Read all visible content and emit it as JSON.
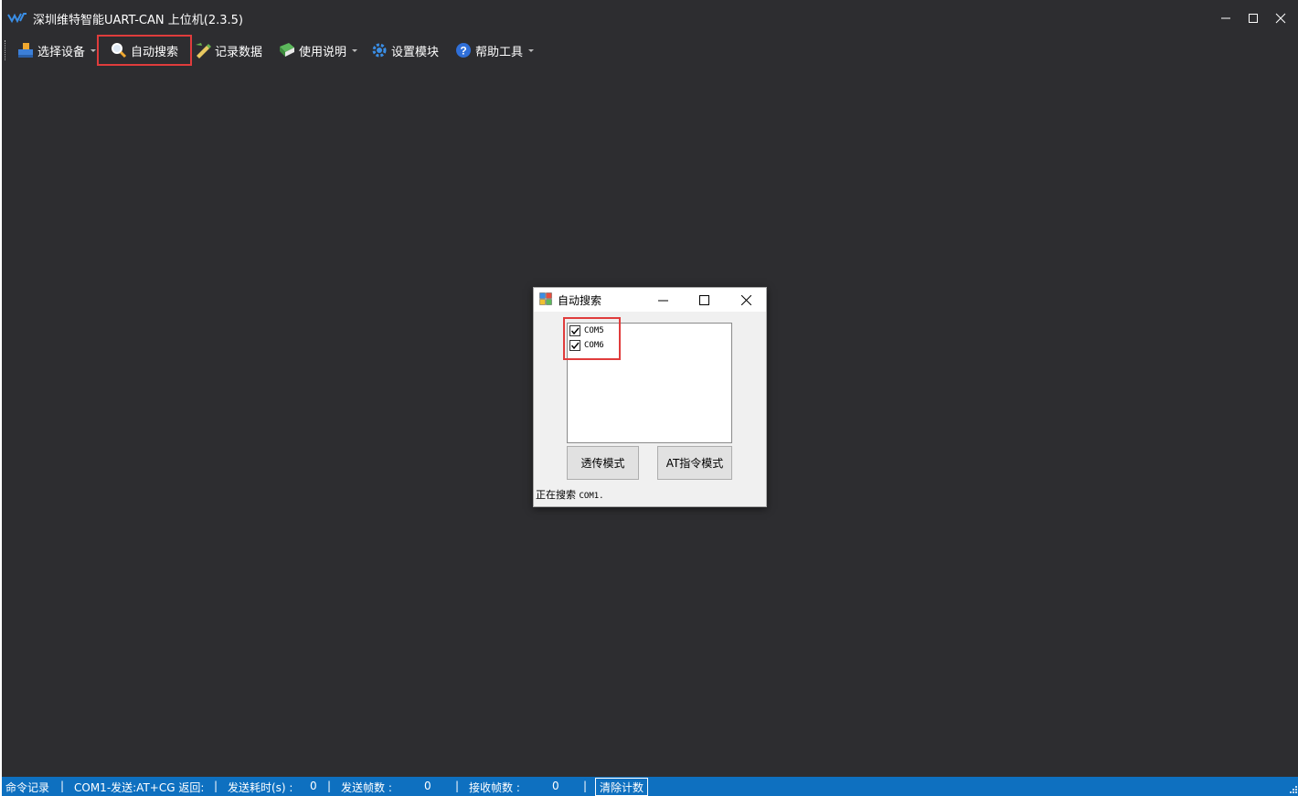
{
  "app": {
    "title": "深圳维特智能UART-CAN 上位机(2.3.5)"
  },
  "toolbar": {
    "items": [
      {
        "label": "选择设备",
        "icon": "device-icon",
        "dropdown": true
      },
      {
        "label": "自动搜索",
        "icon": "search-icon",
        "dropdown": false,
        "highlighted": true
      },
      {
        "label": "记录数据",
        "icon": "record-icon",
        "dropdown": false
      },
      {
        "label": "使用说明",
        "icon": "manual-icon",
        "dropdown": true
      },
      {
        "label": "设置模块",
        "icon": "gear-icon",
        "dropdown": false
      },
      {
        "label": "帮助工具",
        "icon": "help-icon",
        "dropdown": true
      }
    ]
  },
  "dialog": {
    "title": "自动搜索",
    "ports": [
      {
        "label": "COM5",
        "checked": true
      },
      {
        "label": "COM6",
        "checked": true
      }
    ],
    "buttons": {
      "transparent_mode": "透传模式",
      "at_mode": "AT指令模式"
    },
    "status_prefix": "正在搜索",
    "status_port": "COM1."
  },
  "statusbar": {
    "command_log": "命令记录",
    "sep": "|",
    "send_return": "COM1-发送:AT+CG 返回:",
    "send_time_label": "发送耗时(s)  :",
    "send_time_value": "0",
    "send_frames_label": "发送帧数  :",
    "send_frames_value": "0",
    "recv_frames_label": "接收帧数  :",
    "recv_frames_value": "0",
    "clear_button": "清除计数"
  },
  "colors": {
    "background": "#2d2d30",
    "statusbar": "#0e70c0",
    "highlight": "#e03c3c"
  }
}
